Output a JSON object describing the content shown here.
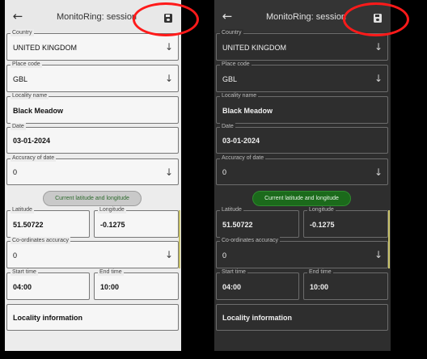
{
  "appbar": {
    "title": "MonitoRing: session",
    "back_icon": "arrow-left-icon",
    "save_icon": "floppy-disk-icon"
  },
  "fields": {
    "country": {
      "label": "Country",
      "value": "UNITED KINGDOM"
    },
    "place_code": {
      "label": "Place code",
      "value": "GBL"
    },
    "locality_name": {
      "label": "Locality name",
      "value": "Black Meadow"
    },
    "date": {
      "label": "Date",
      "value": "03-01-2024"
    },
    "accuracy_of_date": {
      "label": "Accuracy of date",
      "value": "0"
    },
    "latitude": {
      "label": "Latitude",
      "value": "51.50722"
    },
    "longitude": {
      "label": "Longitude",
      "value": "-0.1275"
    },
    "coordinates_accuracy": {
      "label": "Co-ordinates accuracy",
      "value": "0"
    },
    "start_time": {
      "label": "Start time",
      "value": "04:00"
    },
    "end_time": {
      "label": "End time",
      "value": "10:00"
    },
    "locality_information": {
      "label": "Locality information"
    }
  },
  "location_button": {
    "label": "Current latitude and longitude"
  },
  "dropdown_icon": "chevron-down-icon",
  "colors": {
    "highlight_ring": "#ff1a1a",
    "light_location_button": "#c9c9c9",
    "dark_location_button": "#1b6a1b"
  }
}
